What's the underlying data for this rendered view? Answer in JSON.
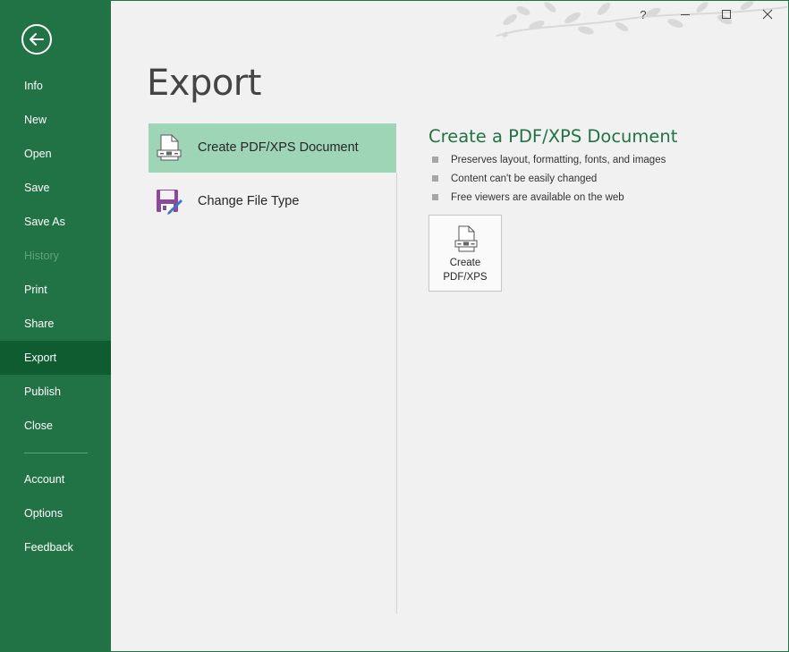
{
  "sidebar": {
    "items": [
      {
        "label": "Info"
      },
      {
        "label": "New"
      },
      {
        "label": "Open"
      },
      {
        "label": "Save"
      },
      {
        "label": "Save As"
      },
      {
        "label": "History",
        "disabled": true
      },
      {
        "label": "Print"
      },
      {
        "label": "Share"
      },
      {
        "label": "Export",
        "active": true
      },
      {
        "label": "Publish"
      },
      {
        "label": "Close"
      },
      {
        "label": "Account"
      },
      {
        "label": "Options"
      },
      {
        "label": "Feedback"
      }
    ]
  },
  "window": {
    "help_label": "?"
  },
  "main": {
    "title": "Export",
    "options": [
      {
        "label": "Create PDF/XPS Document",
        "icon": "pdf-document-icon",
        "selected": true
      },
      {
        "label": "Change File Type",
        "icon": "save-edit-icon",
        "selected": false
      }
    ],
    "detail": {
      "title": "Create a PDF/XPS Document",
      "bullets": [
        "Preserves layout, formatting, fonts, and images",
        "Content can't be easily changed",
        "Free viewers are available on the web"
      ],
      "button_line1": "Create",
      "button_line2": "PDF/XPS"
    }
  },
  "colors": {
    "accent": "#217346",
    "active": "#0f5c31",
    "selected": "#9fd5b7"
  }
}
